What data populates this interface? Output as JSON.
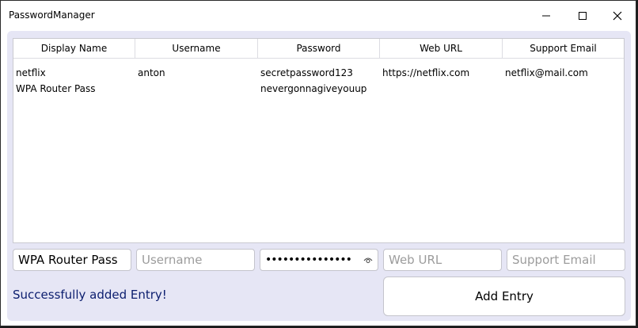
{
  "window": {
    "title": "PasswordManager"
  },
  "table": {
    "columns": [
      "Display Name",
      "Username",
      "Password",
      "Web URL",
      "Support Email"
    ],
    "rows": [
      [
        "netflix",
        "anton",
        "secretpassword123",
        "https://netflix.com",
        "netflix@mail.com"
      ],
      [
        "WPA Router Pass",
        "",
        "nevergonnagiveyouup",
        "",
        ""
      ]
    ]
  },
  "form": {
    "display_name_value": "WPA Router Pass",
    "username_placeholder": "Username",
    "password_masked": "•••••••••••••••",
    "web_url_placeholder": "Web URL",
    "support_email_placeholder": "Support Email",
    "add_button_label": "Add Entry"
  },
  "status": {
    "message": "Successfully added Entry!"
  },
  "colors": {
    "client_bg": "#e6e6f5",
    "status_text": "#0b1d6e"
  }
}
